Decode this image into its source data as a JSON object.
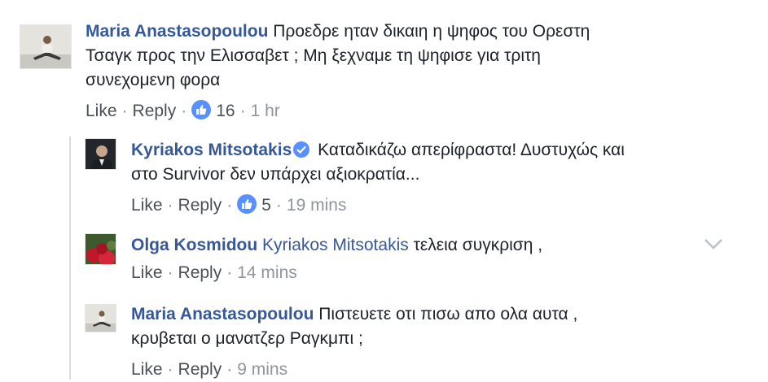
{
  "comments": [
    {
      "author": "Maria Anastasopoulou",
      "text_line1": "Προεδρε ηταν δικαιη η ψηφος του Ορεστη",
      "text_line2": "Τσαγκ προς την Ελισσαβετ ; Μη ξεχναμε τη ψηφισε για τριτη",
      "text_line3": "συνεχομενη φορα",
      "like_label": "Like",
      "reply_label": "Reply",
      "reactions": "16",
      "time": "1 hr"
    },
    {
      "author": "Kyriakos Mitsotakis",
      "verified": true,
      "text_line1": "Καταδικάζω απερίφραστα! Δυστυχώς και",
      "text_line2": "στο Survivor δεν υπάρχει αξιοκρατία...",
      "like_label": "Like",
      "reply_label": "Reply",
      "reactions": "5",
      "time": "19 mins"
    },
    {
      "author": "Olga Kosmidou",
      "mention": "Kyriakos Mitsotakis",
      "text": "τελεια συγκριση ,",
      "like_label": "Like",
      "reply_label": "Reply",
      "time": "14 mins"
    },
    {
      "author": "Maria Anastasopoulou",
      "text_line1": "Πιστευετε οτι πισω απο ολα αυτα ,",
      "text_line2": "κρυβεται ο μανατζερ Ραγκμπι ;",
      "like_label": "Like",
      "reply_label": "Reply",
      "time": "9 mins"
    }
  ],
  "icons": {
    "reaction": "like-thumb-icon",
    "verified": "verified-badge-icon",
    "menu": "chevron-down-icon"
  },
  "colors": {
    "author": "#365899",
    "reaction_blue": "#5890ff",
    "meta_gray": "#90949c"
  }
}
